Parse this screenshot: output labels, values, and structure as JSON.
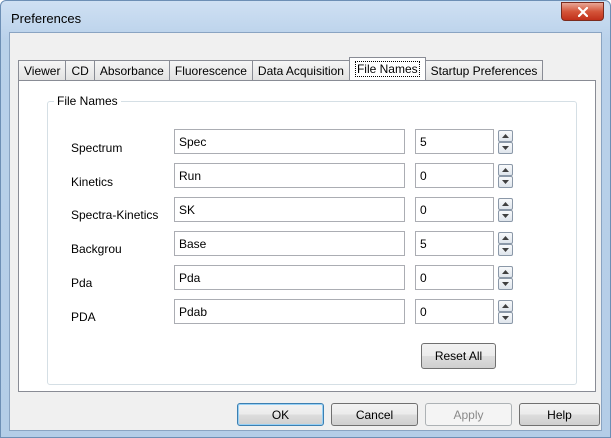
{
  "window": {
    "title": "Preferences"
  },
  "tabs": [
    {
      "label": "Viewer"
    },
    {
      "label": "CD"
    },
    {
      "label": "Absorbance"
    },
    {
      "label": "Fluorescence"
    },
    {
      "label": "Data Acquisition"
    },
    {
      "label": "File Names",
      "active": true
    },
    {
      "label": "Startup Preferences"
    }
  ],
  "file_names": {
    "group_label": "File Names",
    "rows": [
      {
        "label": "Spectrum",
        "name": "Spec",
        "number": "5"
      },
      {
        "label": "Kinetics",
        "name": "Run",
        "number": "0"
      },
      {
        "label": "Spectra-Kinetics",
        "name": "SK",
        "number": "0"
      },
      {
        "label": "Backgrou",
        "name": "Base",
        "number": "5"
      },
      {
        "label": "Pda",
        "name": "Pda",
        "number": "0"
      },
      {
        "label": "PDA",
        "name": "Pdab",
        "number": "0"
      }
    ],
    "reset_label": "Reset All"
  },
  "buttons": {
    "ok": "OK",
    "cancel": "Cancel",
    "apply": "Apply",
    "help": "Help"
  },
  "icons": {
    "close": "close-icon",
    "spin_up": "spin-up-icon",
    "spin_down": "spin-down-icon"
  }
}
